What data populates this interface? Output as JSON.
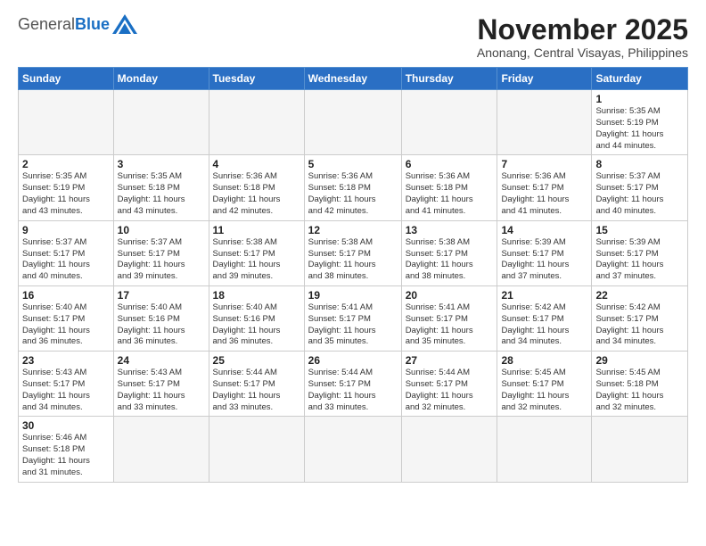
{
  "logo": {
    "general": "General",
    "blue": "Blue"
  },
  "title": "November 2025",
  "subtitle": "Anonang, Central Visayas, Philippines",
  "days_of_week": [
    "Sunday",
    "Monday",
    "Tuesday",
    "Wednesday",
    "Thursday",
    "Friday",
    "Saturday"
  ],
  "weeks": [
    [
      {
        "day": "",
        "info": ""
      },
      {
        "day": "",
        "info": ""
      },
      {
        "day": "",
        "info": ""
      },
      {
        "day": "",
        "info": ""
      },
      {
        "day": "",
        "info": ""
      },
      {
        "day": "",
        "info": ""
      },
      {
        "day": "1",
        "info": "Sunrise: 5:35 AM\nSunset: 5:19 PM\nDaylight: 11 hours\nand 44 minutes."
      }
    ],
    [
      {
        "day": "2",
        "info": "Sunrise: 5:35 AM\nSunset: 5:19 PM\nDaylight: 11 hours\nand 43 minutes."
      },
      {
        "day": "3",
        "info": "Sunrise: 5:35 AM\nSunset: 5:18 PM\nDaylight: 11 hours\nand 43 minutes."
      },
      {
        "day": "4",
        "info": "Sunrise: 5:36 AM\nSunset: 5:18 PM\nDaylight: 11 hours\nand 42 minutes."
      },
      {
        "day": "5",
        "info": "Sunrise: 5:36 AM\nSunset: 5:18 PM\nDaylight: 11 hours\nand 42 minutes."
      },
      {
        "day": "6",
        "info": "Sunrise: 5:36 AM\nSunset: 5:18 PM\nDaylight: 11 hours\nand 41 minutes."
      },
      {
        "day": "7",
        "info": "Sunrise: 5:36 AM\nSunset: 5:17 PM\nDaylight: 11 hours\nand 41 minutes."
      },
      {
        "day": "8",
        "info": "Sunrise: 5:37 AM\nSunset: 5:17 PM\nDaylight: 11 hours\nand 40 minutes."
      }
    ],
    [
      {
        "day": "9",
        "info": "Sunrise: 5:37 AM\nSunset: 5:17 PM\nDaylight: 11 hours\nand 40 minutes."
      },
      {
        "day": "10",
        "info": "Sunrise: 5:37 AM\nSunset: 5:17 PM\nDaylight: 11 hours\nand 39 minutes."
      },
      {
        "day": "11",
        "info": "Sunrise: 5:38 AM\nSunset: 5:17 PM\nDaylight: 11 hours\nand 39 minutes."
      },
      {
        "day": "12",
        "info": "Sunrise: 5:38 AM\nSunset: 5:17 PM\nDaylight: 11 hours\nand 38 minutes."
      },
      {
        "day": "13",
        "info": "Sunrise: 5:38 AM\nSunset: 5:17 PM\nDaylight: 11 hours\nand 38 minutes."
      },
      {
        "day": "14",
        "info": "Sunrise: 5:39 AM\nSunset: 5:17 PM\nDaylight: 11 hours\nand 37 minutes."
      },
      {
        "day": "15",
        "info": "Sunrise: 5:39 AM\nSunset: 5:17 PM\nDaylight: 11 hours\nand 37 minutes."
      }
    ],
    [
      {
        "day": "16",
        "info": "Sunrise: 5:40 AM\nSunset: 5:17 PM\nDaylight: 11 hours\nand 36 minutes."
      },
      {
        "day": "17",
        "info": "Sunrise: 5:40 AM\nSunset: 5:16 PM\nDaylight: 11 hours\nand 36 minutes."
      },
      {
        "day": "18",
        "info": "Sunrise: 5:40 AM\nSunset: 5:16 PM\nDaylight: 11 hours\nand 36 minutes."
      },
      {
        "day": "19",
        "info": "Sunrise: 5:41 AM\nSunset: 5:17 PM\nDaylight: 11 hours\nand 35 minutes."
      },
      {
        "day": "20",
        "info": "Sunrise: 5:41 AM\nSunset: 5:17 PM\nDaylight: 11 hours\nand 35 minutes."
      },
      {
        "day": "21",
        "info": "Sunrise: 5:42 AM\nSunset: 5:17 PM\nDaylight: 11 hours\nand 34 minutes."
      },
      {
        "day": "22",
        "info": "Sunrise: 5:42 AM\nSunset: 5:17 PM\nDaylight: 11 hours\nand 34 minutes."
      }
    ],
    [
      {
        "day": "23",
        "info": "Sunrise: 5:43 AM\nSunset: 5:17 PM\nDaylight: 11 hours\nand 34 minutes."
      },
      {
        "day": "24",
        "info": "Sunrise: 5:43 AM\nSunset: 5:17 PM\nDaylight: 11 hours\nand 33 minutes."
      },
      {
        "day": "25",
        "info": "Sunrise: 5:44 AM\nSunset: 5:17 PM\nDaylight: 11 hours\nand 33 minutes."
      },
      {
        "day": "26",
        "info": "Sunrise: 5:44 AM\nSunset: 5:17 PM\nDaylight: 11 hours\nand 33 minutes."
      },
      {
        "day": "27",
        "info": "Sunrise: 5:44 AM\nSunset: 5:17 PM\nDaylight: 11 hours\nand 32 minutes."
      },
      {
        "day": "28",
        "info": "Sunrise: 5:45 AM\nSunset: 5:17 PM\nDaylight: 11 hours\nand 32 minutes."
      },
      {
        "day": "29",
        "info": "Sunrise: 5:45 AM\nSunset: 5:18 PM\nDaylight: 11 hours\nand 32 minutes."
      }
    ],
    [
      {
        "day": "30",
        "info": "Sunrise: 5:46 AM\nSunset: 5:18 PM\nDaylight: 11 hours\nand 31 minutes."
      },
      {
        "day": "",
        "info": ""
      },
      {
        "day": "",
        "info": ""
      },
      {
        "day": "",
        "info": ""
      },
      {
        "day": "",
        "info": ""
      },
      {
        "day": "",
        "info": ""
      },
      {
        "day": "",
        "info": ""
      }
    ]
  ]
}
